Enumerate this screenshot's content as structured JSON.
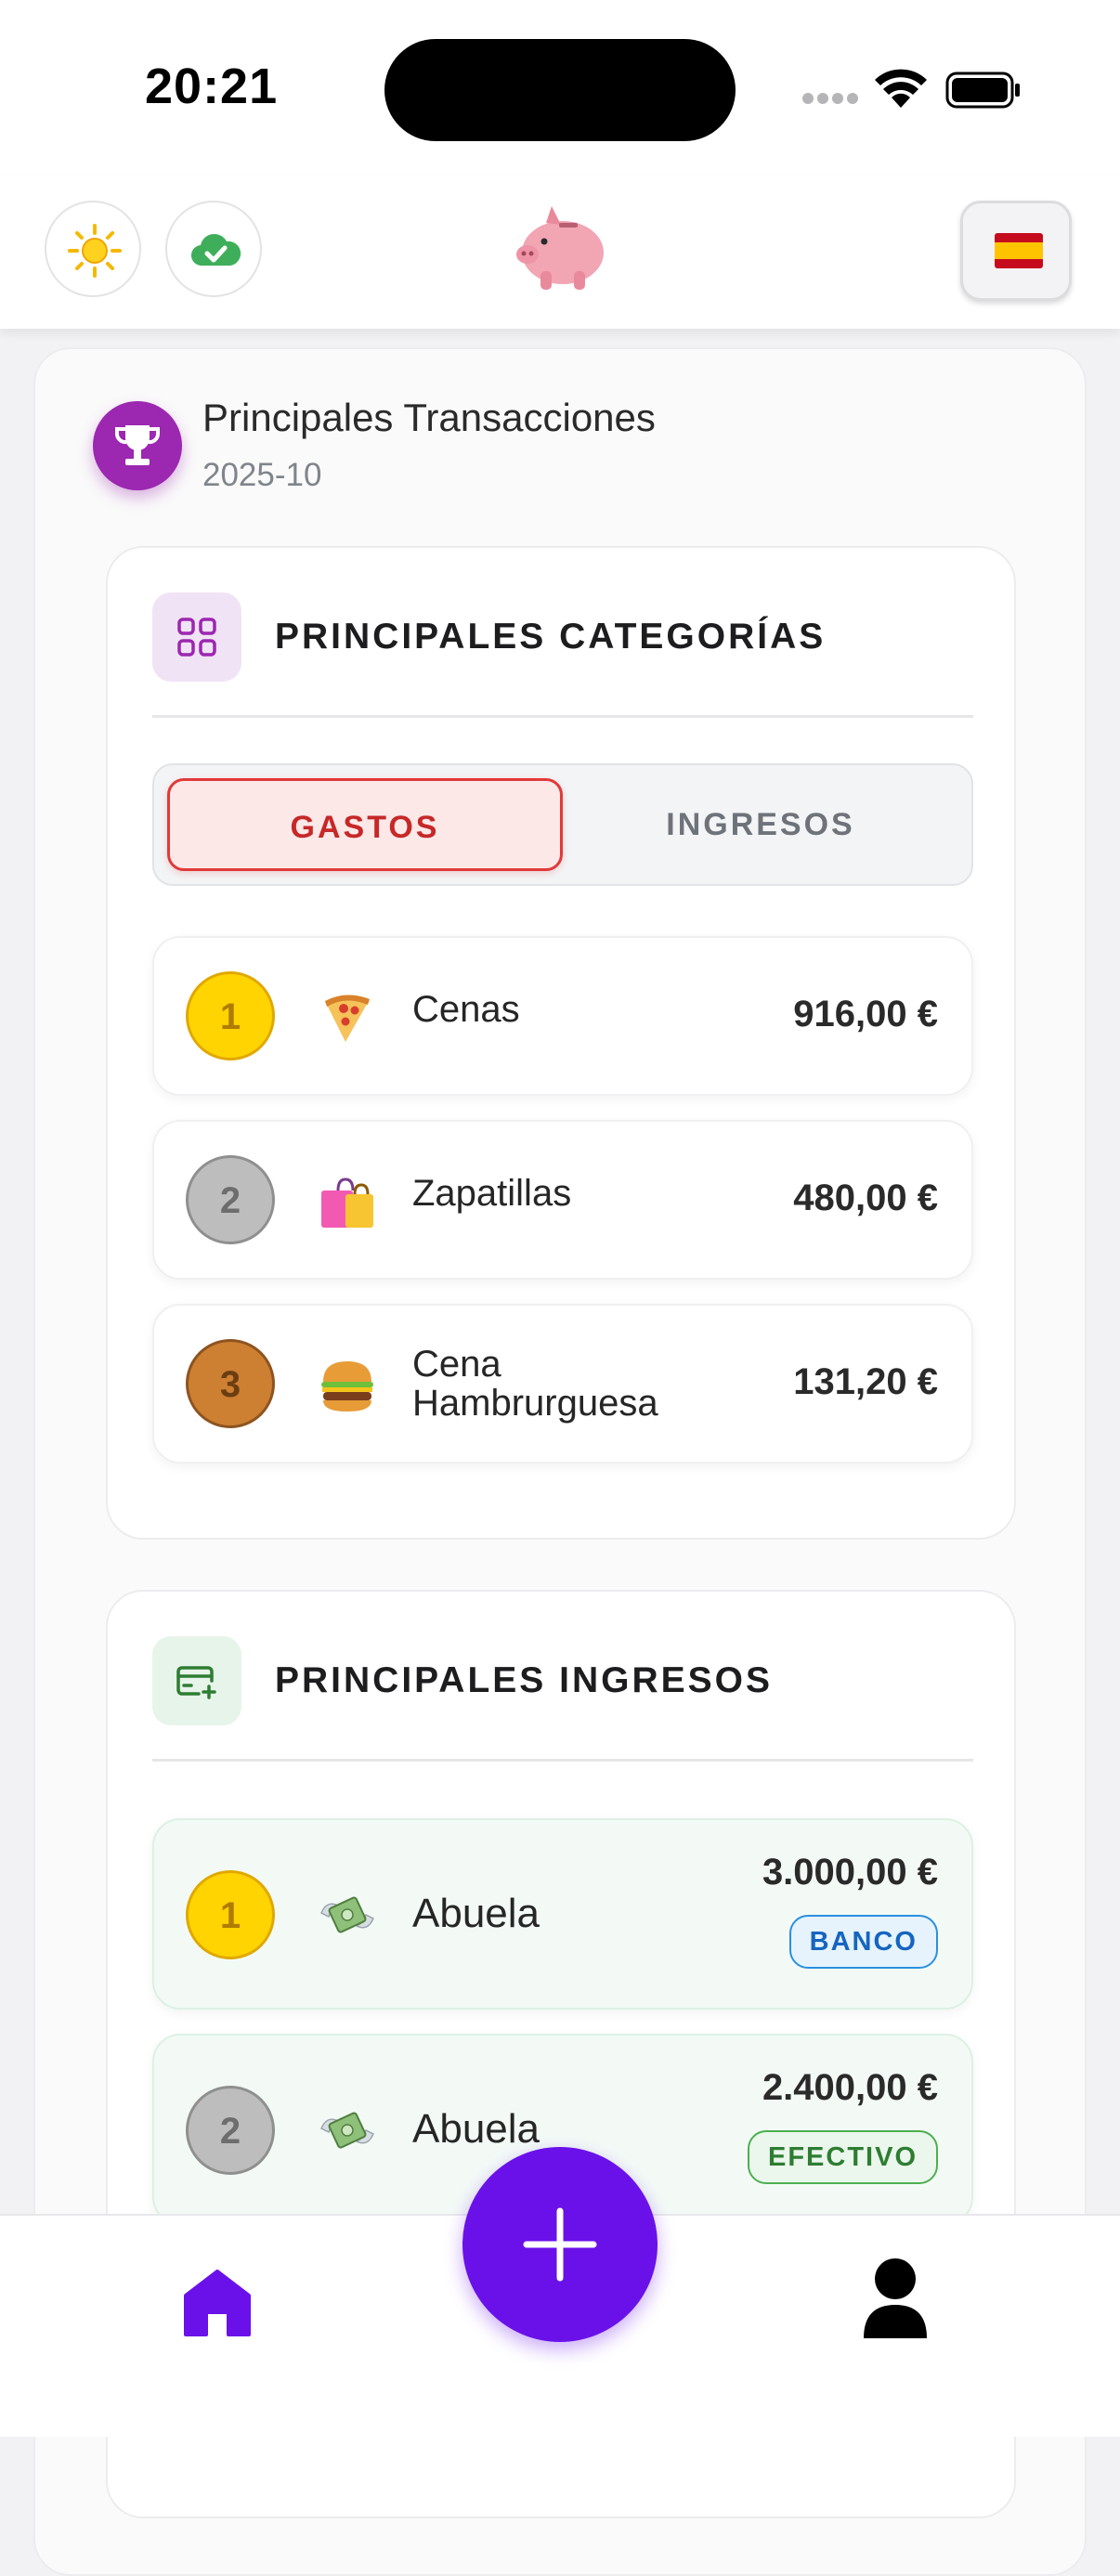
{
  "status_bar": {
    "time": "20:21"
  },
  "header": {
    "theme_icon": "sun-icon",
    "sync_icon": "cloud-check-icon",
    "logo_icon": "piggy-bank-icon",
    "language_icon": "spain-flag-icon"
  },
  "main": {
    "title": "Principales Transacciones",
    "period": "2025-10",
    "title_icon": "trophy-icon"
  },
  "categories": {
    "title": "PRINCIPALES CATEGORÍAS",
    "icon": "grid-icon",
    "tabs": [
      {
        "label": "GASTOS",
        "active": true
      },
      {
        "label": "INGRESOS",
        "active": false
      }
    ],
    "items": [
      {
        "rank": "1",
        "icon": "pizza-icon",
        "name": "Cenas",
        "amount": "916,00 €"
      },
      {
        "rank": "2",
        "icon": "shopping-bags-icon",
        "name": "Zapatillas",
        "amount": "480,00 €"
      },
      {
        "rank": "3",
        "icon": "burger-icon",
        "name_line1": "Cena",
        "name_line2": "Hambrurguesa",
        "amount": "131,20 €"
      }
    ]
  },
  "incomes": {
    "title": "PRINCIPALES INGRESOS",
    "icon": "card-plus-icon",
    "items": [
      {
        "rank": "1",
        "icon": "money-wings-icon",
        "name": "Abuela",
        "amount": "3.000,00 €",
        "badge": "BANCO"
      },
      {
        "rank": "2",
        "icon": "money-wings-icon",
        "name": "Abuela",
        "amount": "2.400,00 €",
        "badge": "EFECTIVO"
      }
    ]
  },
  "bottom_nav": {
    "home_icon": "home-icon",
    "add_icon": "plus-icon",
    "profile_icon": "user-icon"
  },
  "colors": {
    "accent": "#6a11ea",
    "trophy": "#9c27b0",
    "expense": "#e03a3a",
    "bank": "#2b8fe0",
    "cash": "#4caf50"
  }
}
